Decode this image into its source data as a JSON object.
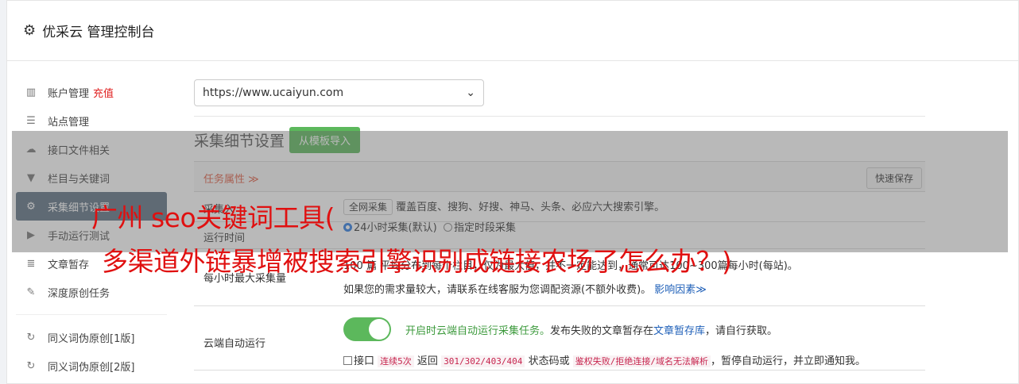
{
  "header": {
    "title": "优采云 管理控制台",
    "icon": "gear-icon"
  },
  "sidebar": {
    "items": [
      {
        "label": "账户管理",
        "badge": "充值",
        "icon": "bar-chart-icon"
      },
      {
        "label": "站点管理",
        "icon": "server-icon"
      },
      {
        "label": "接口文件相关",
        "icon": "cloud-upload-icon"
      },
      {
        "label": "栏目与关键词",
        "icon": "filter-icon"
      },
      {
        "label": "采集细节设置",
        "icon": "gears-icon",
        "active": true
      },
      {
        "label": "手动运行测试",
        "icon": "play-circle-icon"
      },
      {
        "label": "文章暂存",
        "icon": "database-icon"
      },
      {
        "label": "深度原创任务",
        "icon": "edit-icon"
      }
    ],
    "items2": [
      {
        "label": "同义词伪原创[1版]",
        "icon": "refresh-icon"
      },
      {
        "label": "同义词伪原创[2版]",
        "icon": "refresh-icon"
      }
    ]
  },
  "main": {
    "site_select": "https://www.ucaiyun.com",
    "section_title": "采集细节设置",
    "import_button": "从模板导入",
    "task_attr": "任务属性 ≫",
    "quick_save": "快速保存",
    "rows": {
      "r1_label": "采集入",
      "r1_btn": "全网采集",
      "r1_text": "覆盖百度、搜狗、好搜、神马、头条、必应六大搜索引擎。",
      "r2_label": "运行时间",
      "r2_opt1": "24小时采集(默认)",
      "r2_opt2": "指定时段采集",
      "r3_label": "每小时最大采集量",
      "r3_line1_a": "100",
      "r3_line1_b": "篇",
      "r3_line1_c": "平均分布到每个栏目，仅为最大值，并不一定能达到，通常可达100~300篇每小时(每站)。",
      "r3_line2": "如果您的需求量较大，请联系在线客服为您调配资源(不额外收费)。",
      "r3_link": "影响因素≫",
      "r4_label": "云端自动运行",
      "r4_green": "开启时云端自动运行采集任务。",
      "r4_text": "发布失败的文章暂存在",
      "r4_link": "文章暂存库",
      "r4_text2": "，请自行获取。",
      "r4_l2_a": "接口",
      "r4_code1": "连续5次",
      "r4_l2_b": "返回",
      "r4_code2": "301/302/403/404",
      "r4_l2_c": "状态码或",
      "r4_code3": "鉴权失败/拒绝连接/域名无法解析",
      "r4_l2_d": "，暂停自动运行，并立即通知我。"
    }
  },
  "overlay": {
    "line1": "广州 seo关键词工具(",
    "line2": "多渠道外链暴增被搜索引擎识别成链接农场了怎么办？)"
  },
  "colors": {
    "active_bg": "#5b6f82",
    "green": "#5cb85c",
    "accent_red": "#e01010"
  }
}
